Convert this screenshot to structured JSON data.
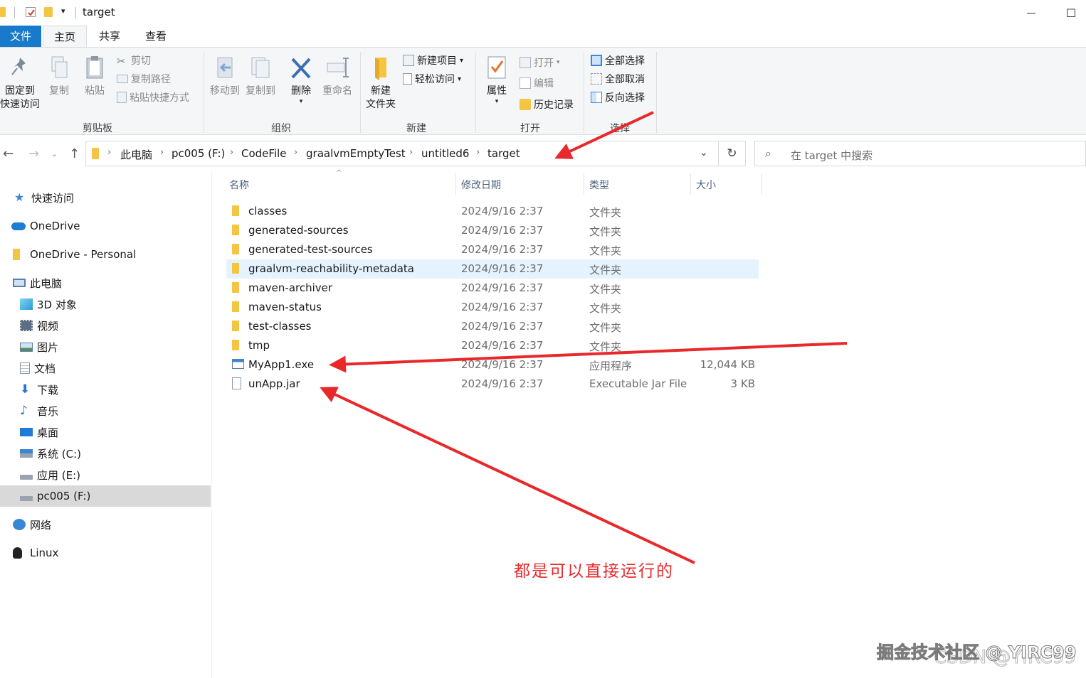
{
  "window": {
    "title": "target",
    "minimize_glyph": "—",
    "maximize_glyph": "☐"
  },
  "ribbon_tabs": [
    {
      "label": "文件"
    },
    {
      "label": "主页"
    },
    {
      "label": "共享"
    },
    {
      "label": "查看"
    }
  ],
  "ribbon": {
    "clipboard": {
      "pin_label_1": "固定到",
      "pin_label_2": "快速访问",
      "copy_label": "复制",
      "paste_label": "粘贴",
      "cut_label": "剪切",
      "copy_path_label": "复制路径",
      "paste_shortcut_label": "粘贴快捷方式",
      "group_label": "剪贴板"
    },
    "organize": {
      "move_to_label": "移动到",
      "copy_to_label": "复制到",
      "delete_label": "删除",
      "rename_label": "重命名",
      "group_label": "组织"
    },
    "new": {
      "new_folder_label_1": "新建",
      "new_folder_label_2": "文件夹",
      "new_item_label": "新建项目",
      "easy_access_label": "轻松访问",
      "group_label": "新建"
    },
    "open": {
      "properties_label": "属性",
      "open_label": "打开",
      "edit_label": "编辑",
      "history_label": "历史记录",
      "group_label": "打开"
    },
    "select": {
      "select_all_label": "全部选择",
      "select_none_label": "全部取消",
      "invert_label": "反向选择",
      "group_label": "选择"
    }
  },
  "address": {
    "crumbs": [
      "此电脑",
      "pc005 (F:)",
      "CodeFile",
      "graalvmEmptyTest",
      "untitled6",
      "target"
    ],
    "search_placeholder": "在 target 中搜索"
  },
  "nav_pane": {
    "items": [
      {
        "label": "快速访问"
      },
      {
        "label": "OneDrive"
      },
      {
        "label": "OneDrive - Personal"
      },
      {
        "label": "此电脑"
      },
      {
        "label": "3D 对象"
      },
      {
        "label": "视频"
      },
      {
        "label": "图片"
      },
      {
        "label": "文档"
      },
      {
        "label": "下载"
      },
      {
        "label": "音乐"
      },
      {
        "label": "桌面"
      },
      {
        "label": "系统 (C:)"
      },
      {
        "label": "应用 (E:)"
      },
      {
        "label": "pc005 (F:)"
      },
      {
        "label": "网络"
      },
      {
        "label": "Linux"
      }
    ],
    "selected": "pc005 (F:)"
  },
  "file_list": {
    "headers": {
      "name": "名称",
      "modified": "修改日期",
      "type": "类型",
      "size": "大小"
    },
    "rows": [
      {
        "name": "classes",
        "modified": "2024/9/16 2:37",
        "type": "文件夹",
        "size": "",
        "kind": "folder"
      },
      {
        "name": "generated-sources",
        "modified": "2024/9/16 2:37",
        "type": "文件夹",
        "size": "",
        "kind": "folder"
      },
      {
        "name": "generated-test-sources",
        "modified": "2024/9/16 2:37",
        "type": "文件夹",
        "size": "",
        "kind": "folder"
      },
      {
        "name": "graalvm-reachability-metadata",
        "modified": "2024/9/16 2:37",
        "type": "文件夹",
        "size": "",
        "kind": "folder"
      },
      {
        "name": "maven-archiver",
        "modified": "2024/9/16 2:37",
        "type": "文件夹",
        "size": "",
        "kind": "folder"
      },
      {
        "name": "maven-status",
        "modified": "2024/9/16 2:37",
        "type": "文件夹",
        "size": "",
        "kind": "folder"
      },
      {
        "name": "test-classes",
        "modified": "2024/9/16 2:37",
        "type": "文件夹",
        "size": "",
        "kind": "folder"
      },
      {
        "name": "tmp",
        "modified": "2024/9/16 2:37",
        "type": "文件夹",
        "size": "",
        "kind": "folder"
      },
      {
        "name": "MyApp1.exe",
        "modified": "2024/9/16 2:37",
        "type": "应用程序",
        "size": "12,044 KB",
        "kind": "exe"
      },
      {
        "name": "unApp.jar",
        "modified": "2024/9/16 2:37",
        "type": "Executable Jar File",
        "size": "3 KB",
        "kind": "jar"
      }
    ],
    "hovered_row": "graalvm-reachability-metadata"
  },
  "annotation": {
    "note": "都是可以直接运行的",
    "arrow_color": "#e8282b"
  },
  "watermark": {
    "line1": "掘金技术社区 @ YIRC99",
    "line2": "CSDN @YIRC99"
  }
}
